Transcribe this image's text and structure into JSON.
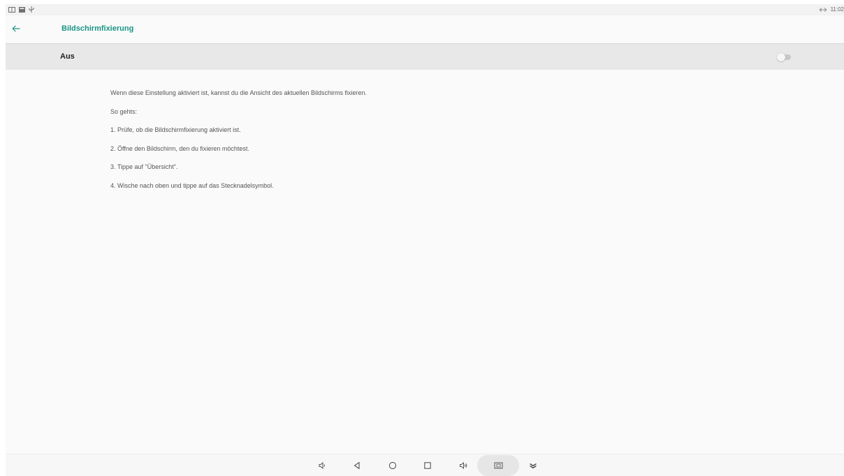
{
  "status_bar": {
    "left_icons": [
      "window-icon",
      "image-icon",
      "usb-icon"
    ],
    "right_icons": [
      "sync-arrows-icon"
    ],
    "time": "11:02"
  },
  "app_bar": {
    "back_icon": "arrow-left-icon",
    "title": "Bildschirmfixierung"
  },
  "master_switch": {
    "label": "Aus",
    "state": "off"
  },
  "description": {
    "intro": "Wenn diese Einstellung aktiviert ist, kannst du die Ansicht des aktuellen Bildschirms fixieren.",
    "howto": "So gehts:",
    "steps": [
      "1. Prüfe, ob die Bildschirmfixierung aktiviert ist.",
      "2. Öffne den Bildschirm, den du fixieren möchtest.",
      "3. Tippe auf \"Übersicht\".",
      "4. Wische nach oben und tippe auf das Stecknadelsymbol."
    ]
  },
  "nav_bar": {
    "buttons": [
      "volume-down-icon",
      "back-triangle-icon",
      "home-circle-icon",
      "recents-square-icon",
      "volume-up-icon",
      "screenshot-icon",
      "collapse-chevrons-icon"
    ]
  },
  "colors": {
    "accent": "#1a9384",
    "switch_row_bg": "#e8e8e8",
    "background": "#fafafa"
  }
}
